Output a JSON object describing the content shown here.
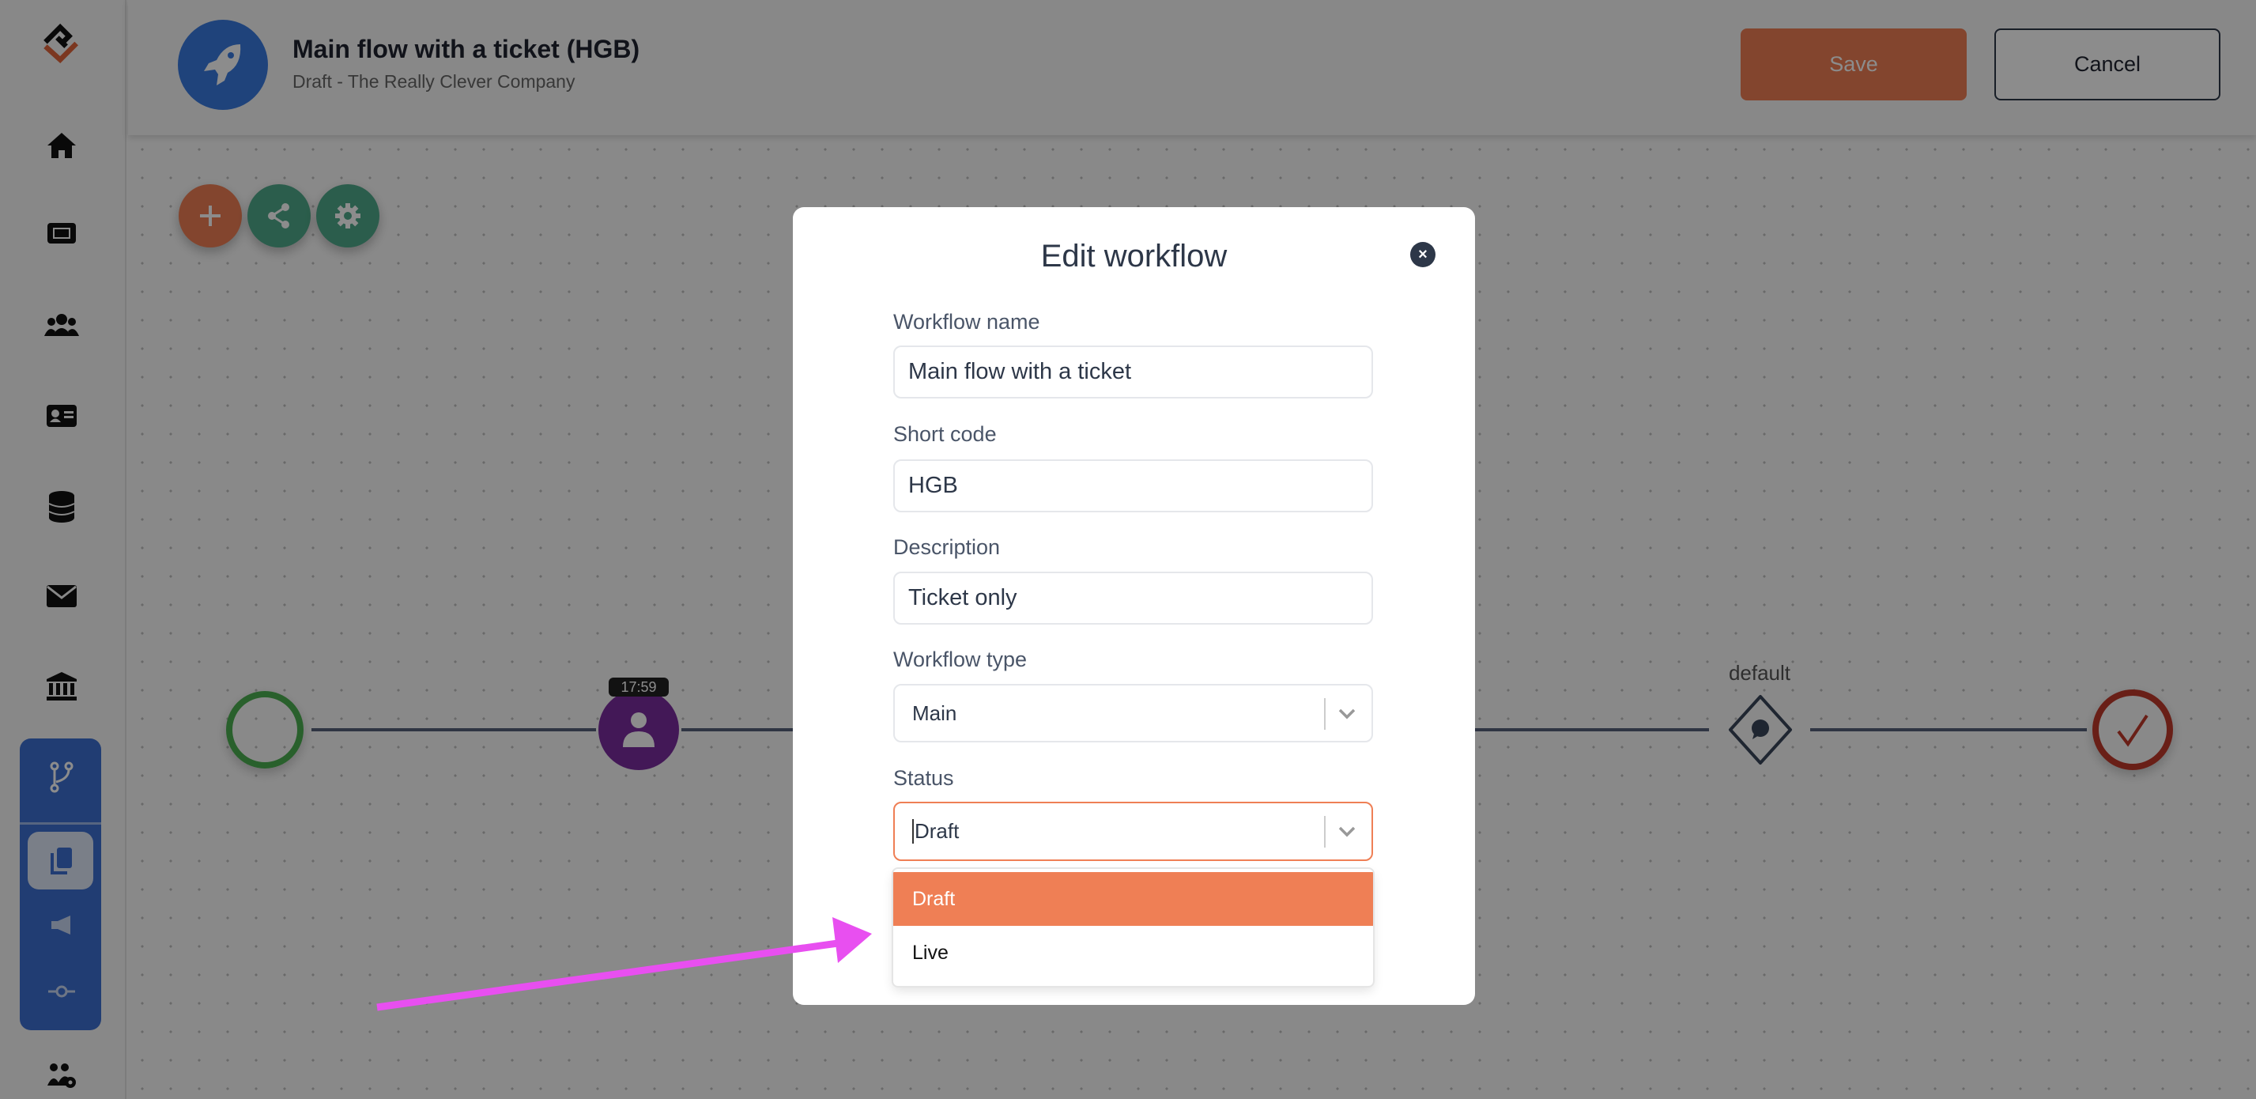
{
  "header": {
    "title": "Main flow with a ticket (HGB)",
    "subtitle": "Draft - The Really Clever Company",
    "save_label": "Save",
    "cancel_label": "Cancel",
    "avatar_icon": "rocket-icon"
  },
  "sidebar": {
    "items": [
      {
        "icon": "home-icon"
      },
      {
        "icon": "ticket-icon"
      },
      {
        "icon": "users-icon"
      },
      {
        "icon": "id-card-icon"
      },
      {
        "icon": "database-icon"
      },
      {
        "icon": "envelope-icon"
      },
      {
        "icon": "bank-icon"
      },
      {
        "icon": "branch-icon"
      },
      {
        "icon": "copy-icon",
        "selected": true
      },
      {
        "icon": "megaphone-icon"
      },
      {
        "icon": "commit-icon"
      },
      {
        "icon": "users-cog-icon"
      }
    ]
  },
  "toolbar": {
    "actions": [
      "add-icon",
      "share-icon",
      "gear-icon"
    ]
  },
  "flow": {
    "timer_badge": "17:59",
    "gateway_label": "default"
  },
  "modal": {
    "title": "Edit workflow",
    "fields": {
      "name_label": "Workflow name",
      "name_value": "Main flow with a ticket",
      "code_label": "Short code",
      "code_value": "HGB",
      "description_label": "Description",
      "description_value": "Ticket only",
      "type_label": "Workflow type",
      "type_value": "Main",
      "status_label": "Status",
      "status_value": "Draft"
    },
    "status_options": [
      "Draft",
      "Live"
    ],
    "highlighted_option": "Draft"
  },
  "colors": {
    "accent": "#ef7f55",
    "sidebar_group": "#3c6fd1",
    "annotation_arrow": "#e84ff0"
  }
}
